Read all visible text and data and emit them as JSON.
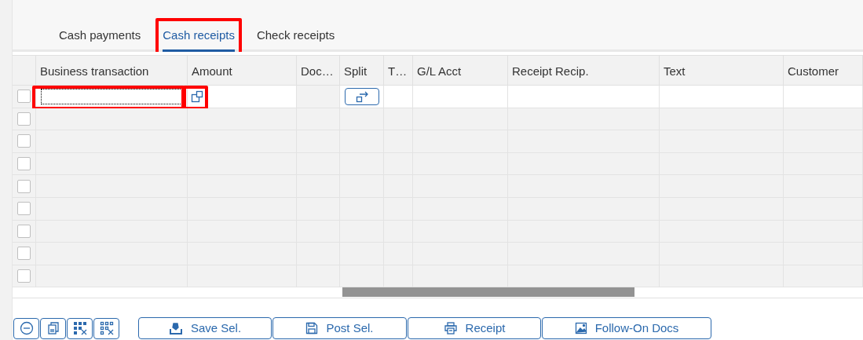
{
  "tabs": [
    {
      "label": "Cash payments",
      "selected": false,
      "highlighted": false
    },
    {
      "label": "Cash receipts",
      "selected": true,
      "highlighted": true
    },
    {
      "label": "Check receipts",
      "selected": false,
      "highlighted": false
    }
  ],
  "table": {
    "columns": [
      "Business transaction",
      "Amount",
      "Doc…",
      "Split",
      "T…",
      "G/L Acct",
      "Receipt Recip.",
      "Text",
      "Customer"
    ],
    "rows": [
      {
        "editable": true,
        "focused": true,
        "field_highlighted": true,
        "value_help_highlighted": true
      },
      {
        "editable": false
      },
      {
        "editable": false
      },
      {
        "editable": false
      },
      {
        "editable": false
      },
      {
        "editable": false
      },
      {
        "editable": false
      },
      {
        "editable": false
      },
      {
        "editable": false
      }
    ]
  },
  "icon_buttons": [
    {
      "kind": "delete"
    },
    {
      "kind": "copy"
    },
    {
      "kind": "select_all"
    },
    {
      "kind": "deselect_all"
    }
  ],
  "buttons": [
    {
      "label": "Save Sel.",
      "kind": "save"
    },
    {
      "label": "Post Sel.",
      "kind": "post"
    },
    {
      "label": "Receipt",
      "kind": "print"
    },
    {
      "label": "Follow-On Docs",
      "kind": "docs"
    }
  ]
}
